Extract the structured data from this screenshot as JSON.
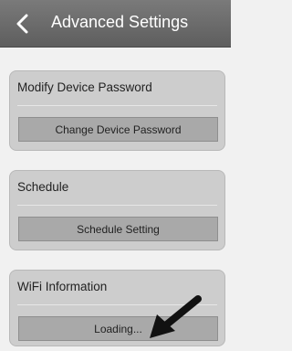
{
  "header": {
    "back_icon": "back-chevron-icon",
    "title": "Advanced Settings"
  },
  "sections": [
    {
      "title": "Modify Device Password",
      "button_label": "Change Device Password"
    },
    {
      "title": "Schedule",
      "button_label": "Schedule Setting"
    },
    {
      "title": "WiFi Information",
      "button_label": "Loading..."
    }
  ],
  "colors": {
    "header": "#6a6a6a",
    "card": "#cdcdcd",
    "button": "#a9a9a9",
    "arrow": "#111111"
  }
}
